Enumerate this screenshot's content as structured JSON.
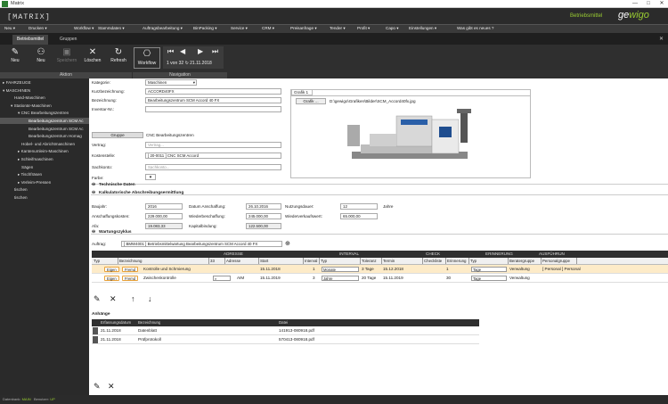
{
  "window": {
    "title": "Matrix",
    "min": "—",
    "max": "□",
    "close": "✕"
  },
  "header": {
    "brand": "[MATRIX]",
    "context": "Betriebsmittel",
    "logo_a": "ge",
    "logo_b": "wigo"
  },
  "menu": [
    {
      "label": "Neu ▾"
    },
    {
      "label": "Drucken ▾"
    },
    {
      "label": "Workflow ▾"
    },
    {
      "label": "Stammdaten ▾"
    },
    {
      "label": "Auftragsbearbeitung ▾"
    },
    {
      "label": "BinPacking ▾"
    },
    {
      "label": "Service ▾"
    },
    {
      "label": "CRM ▾"
    },
    {
      "label": "Preisanfrage ▾"
    },
    {
      "label": "Tender ▾"
    },
    {
      "label": "Profit ▾"
    },
    {
      "label": "Capo ▾"
    },
    {
      "label": "Einstellungen ▾"
    },
    {
      "label": "Was gibt es neues ?"
    }
  ],
  "tabs": [
    {
      "label": "Betriebsmittel"
    },
    {
      "label": "Gruppen"
    }
  ],
  "toolbar": {
    "neu": "Neu",
    "neu2": "Neu",
    "speichern": "Speichern",
    "loeschen": "Löschen",
    "refresh": "Refresh",
    "workflow": "Workflow",
    "aktion": "Aktion",
    "navigation": "Navigation",
    "nav_count": "1 von 32",
    "nav_date": "21.11.2018",
    "close": "✕"
  },
  "tree": [
    {
      "label": "▸ FAHRZEUGE",
      "x": 3
    },
    {
      "label": "▾ MASCHINEN",
      "x": 3
    },
    {
      "label": "Hand-Maschinen",
      "x": 16
    },
    {
      "label": "▾ Stationär-Maschinen",
      "x": 12
    },
    {
      "label": "▾ CNC Bearbeitungszentren",
      "x": 20
    },
    {
      "label": "Bearbeitungszentrum SCM Ac",
      "x": 32,
      "sel": true
    },
    {
      "label": "Bearbeitungszentrum SCM Ac",
      "x": 32
    },
    {
      "label": "Bearbeitungszentrum Homag",
      "x": 32
    },
    {
      "label": "Hobel- und Abrichtmaschinen",
      "x": 24
    },
    {
      "label": "▸ Kantenumleim-Maschinen",
      "x": 20
    },
    {
      "label": "▸ Schleifmaschinen",
      "x": 20
    },
    {
      "label": "Sägen",
      "x": 24
    },
    {
      "label": "▸ Tischfräsen",
      "x": 20
    },
    {
      "label": "▸ Verleim-Pressen",
      "x": 20
    },
    {
      "label": "tischen",
      "x": 16
    },
    {
      "label": "tischen",
      "x": 16
    }
  ],
  "form": {
    "kategorie_l": "Kategorie:",
    "kategorie": "Maschinen",
    "kurz_l": "Kurzbezeichnung:",
    "kurz": "ACCORD40FX",
    "bez_l": "Bezeichnung:",
    "bez": "Bearbeitungszentrum SCM Accord 40 FX",
    "inv_l": "Inventar-Nr.:",
    "inv": "",
    "grafik_tab": "Grafik 1",
    "grafik_btn": "Grafik ...",
    "grafik_path": "D:\\gewigo\\Grafiken\\Bilder\\SCM_Accord40fx.jpg",
    "gruppe_btn": "Gruppe",
    "gruppe": "CNC Bearbeitungszentren",
    "vertrag_l": "Vertrag:",
    "vertrag": "Vertrag...",
    "kst_l": "Kostenstelle:",
    "kst": "[ 20-0011 ] CNC SCM Accord",
    "sach_l": "Sachkonto:",
    "sach": "Sachkonto...",
    "farbe_l": "Farbe:"
  },
  "tech": {
    "title": "Technische Daten"
  },
  "kalk": {
    "title": "Kalkulatorische Abschreibungsermittlung",
    "baujahr_l": "Baujahr:",
    "baujahr": "2016",
    "datum_l": "Datum Anschaffung:",
    "datum": "26.10.2016",
    "nutz_l": "Nutzungsdauer:",
    "nutz": "12",
    "jahre": "Jahre",
    "akost_l": "Anschaffungskosten:",
    "akost": "229.000,00",
    "wbes_l": "Wiederbeschaffung:",
    "wbes": "245.000,00",
    "wkauf_l": "Wiederverkaufswert:",
    "wkauf": "65.000,00",
    "afa_l": "Afa:",
    "afa": "19.083,33",
    "kbind_l": "Kapitalbindung:",
    "kbind": "122.500,00"
  },
  "wartung": {
    "title": "Wartungszyklus",
    "auftrag_l": "Auftrag:",
    "auftrag": "[ BMW4001 ] Betriebsmittelwartung Bearbeitungszentrum SCM Accord 40 FX",
    "groups": [
      "ADRESSE",
      "INTERVAL",
      "CHECK",
      "ERINNERUNG",
      "AUSFÜHRUN"
    ],
    "cols": [
      "Typ",
      "Bezeichnung",
      "33",
      "Adresse",
      "Start",
      "Interval",
      "Typ",
      "Toleranz",
      "Termin",
      "Checkliste",
      "Erinnerung",
      "Typ",
      "Beratergruppe",
      "Personalgruppe"
    ],
    "rows": [
      {
        "eigen": "Eigen",
        "fremd": "Fremd",
        "bez": "Kontrolle und Schmierung",
        "adr": "",
        "start": "15.11.2018",
        "interval": "1",
        "typ": "Monate",
        "tol": "3 Tage",
        "termin": "15.12.2018",
        "erin": "1",
        "etyp": "Tage",
        "berater": "Verwaltung",
        "personal": "[ Personal ] Personal"
      },
      {
        "eigen": "Eigen",
        "fremd": "Fremd",
        "bez": "Zwischenkontrolle",
        "adr": "AIM",
        "start": "15.11.2019",
        "interval": "3",
        "typ": "Jahre",
        "tol": "20 Tage",
        "termin": "15.11.2019",
        "erin": "30",
        "etyp": "Tage",
        "berater": "Verwaltung",
        "personal": ""
      }
    ]
  },
  "anhaenge": {
    "title": "Anhänge",
    "cols": [
      "Erfassungsdatum",
      "Bezeichnung",
      "Datei"
    ],
    "rows": [
      {
        "datum": "21.11.2018",
        "bez": "Datenblatt",
        "datei": "141913-080918.pdf"
      },
      {
        "datum": "21.11.2018",
        "bez": "Prüfprotokoll",
        "datei": "570413-080918.pdf"
      }
    ]
  },
  "status": {
    "a": "Datenbank:",
    "av": "MAIN",
    "b": "Benutzer:",
    "bv": "UP"
  },
  "colors": {
    "accent": "#9acd32",
    "highlight": "#fdebc8",
    "pill_border": "#e8a23a"
  },
  "icons": [
    "edit-icon",
    "delete-icon",
    "arrow-up-icon",
    "arrow-down-icon"
  ]
}
